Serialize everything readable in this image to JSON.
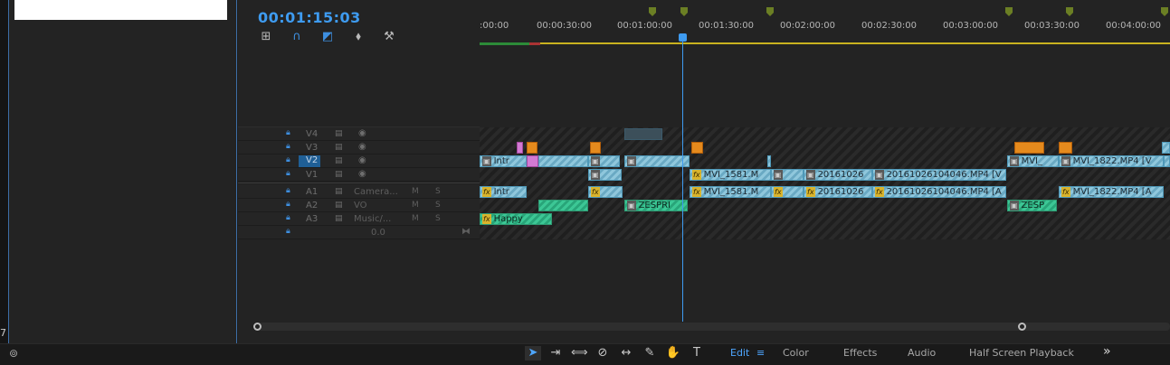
{
  "timecode": "00:01:15:03",
  "left": {
    "corner_number": "7"
  },
  "tools": [
    {
      "name": "insert-icon",
      "glyph": "⊞"
    },
    {
      "name": "snap-icon",
      "glyph": "∩"
    },
    {
      "name": "linked-selection-icon",
      "glyph": "◩"
    },
    {
      "name": "marker-icon",
      "glyph": "⬧"
    },
    {
      "name": "wrench-icon",
      "glyph": "🔧"
    }
  ],
  "ruler_labels": [
    ":00:00",
    "00:00:30:00",
    "00:01:00:00",
    "00:01:30:00",
    "00:02:00:00",
    "00:02:30:00",
    "00:03:00:00",
    "00:03:30:00",
    "00:04:00:00"
  ],
  "video_tracks": [
    {
      "name": "V4",
      "active": false
    },
    {
      "name": "V3",
      "active": false
    },
    {
      "name": "V2",
      "active": true
    },
    {
      "name": "V1",
      "active": false
    }
  ],
  "audio_tracks": [
    {
      "name": "A1",
      "label": "Camera...",
      "m": "M",
      "s": "S"
    },
    {
      "name": "A2",
      "label": "VO",
      "m": "M",
      "s": "S"
    },
    {
      "name": "A3",
      "label": "Music/...",
      "m": "M",
      "s": "S"
    }
  ],
  "master": {
    "value": "0.0"
  },
  "clips": {
    "v2_intro": "Intr",
    "v1_mvi1581": "MVI_1581.M",
    "v1_2016a": "20161026",
    "v1_2016b": "20161026104046.MP4 [V",
    "v2_mvi": "MVI_",
    "v2_mvi1822": "MVI_1822.MP4 [V",
    "a1_intro": "Intr",
    "a1_mvi1581": "MVI_1581.M",
    "a1_2016a": "20161026",
    "a1_2016b": "20161026104046.MP4 [A",
    "a1_mvi1822": "MVI_1822.MP4 [A",
    "a2_zespri": "ZESPRI",
    "a2_zespri2": "ZESP",
    "a3_happy": "Happy"
  },
  "workspaces": [
    {
      "label": "Edit",
      "active": true
    },
    {
      "label": "Color",
      "active": false
    },
    {
      "label": "Effects",
      "active": false
    },
    {
      "label": "Audio",
      "active": false
    },
    {
      "label": "Half Screen Playback",
      "active": false
    }
  ],
  "bottom_tools": [
    "selection-tool",
    "track-select-tool",
    "ripple-edit-tool",
    "razor-tool",
    "slip-tool",
    "pen-tool",
    "hand-tool",
    "type-tool"
  ],
  "colors": {
    "accent": "#3e9bf0",
    "clip_blue": "#8fc7dc",
    "clip_green": "#3cc795",
    "marker_orange": "#e58a1d"
  }
}
